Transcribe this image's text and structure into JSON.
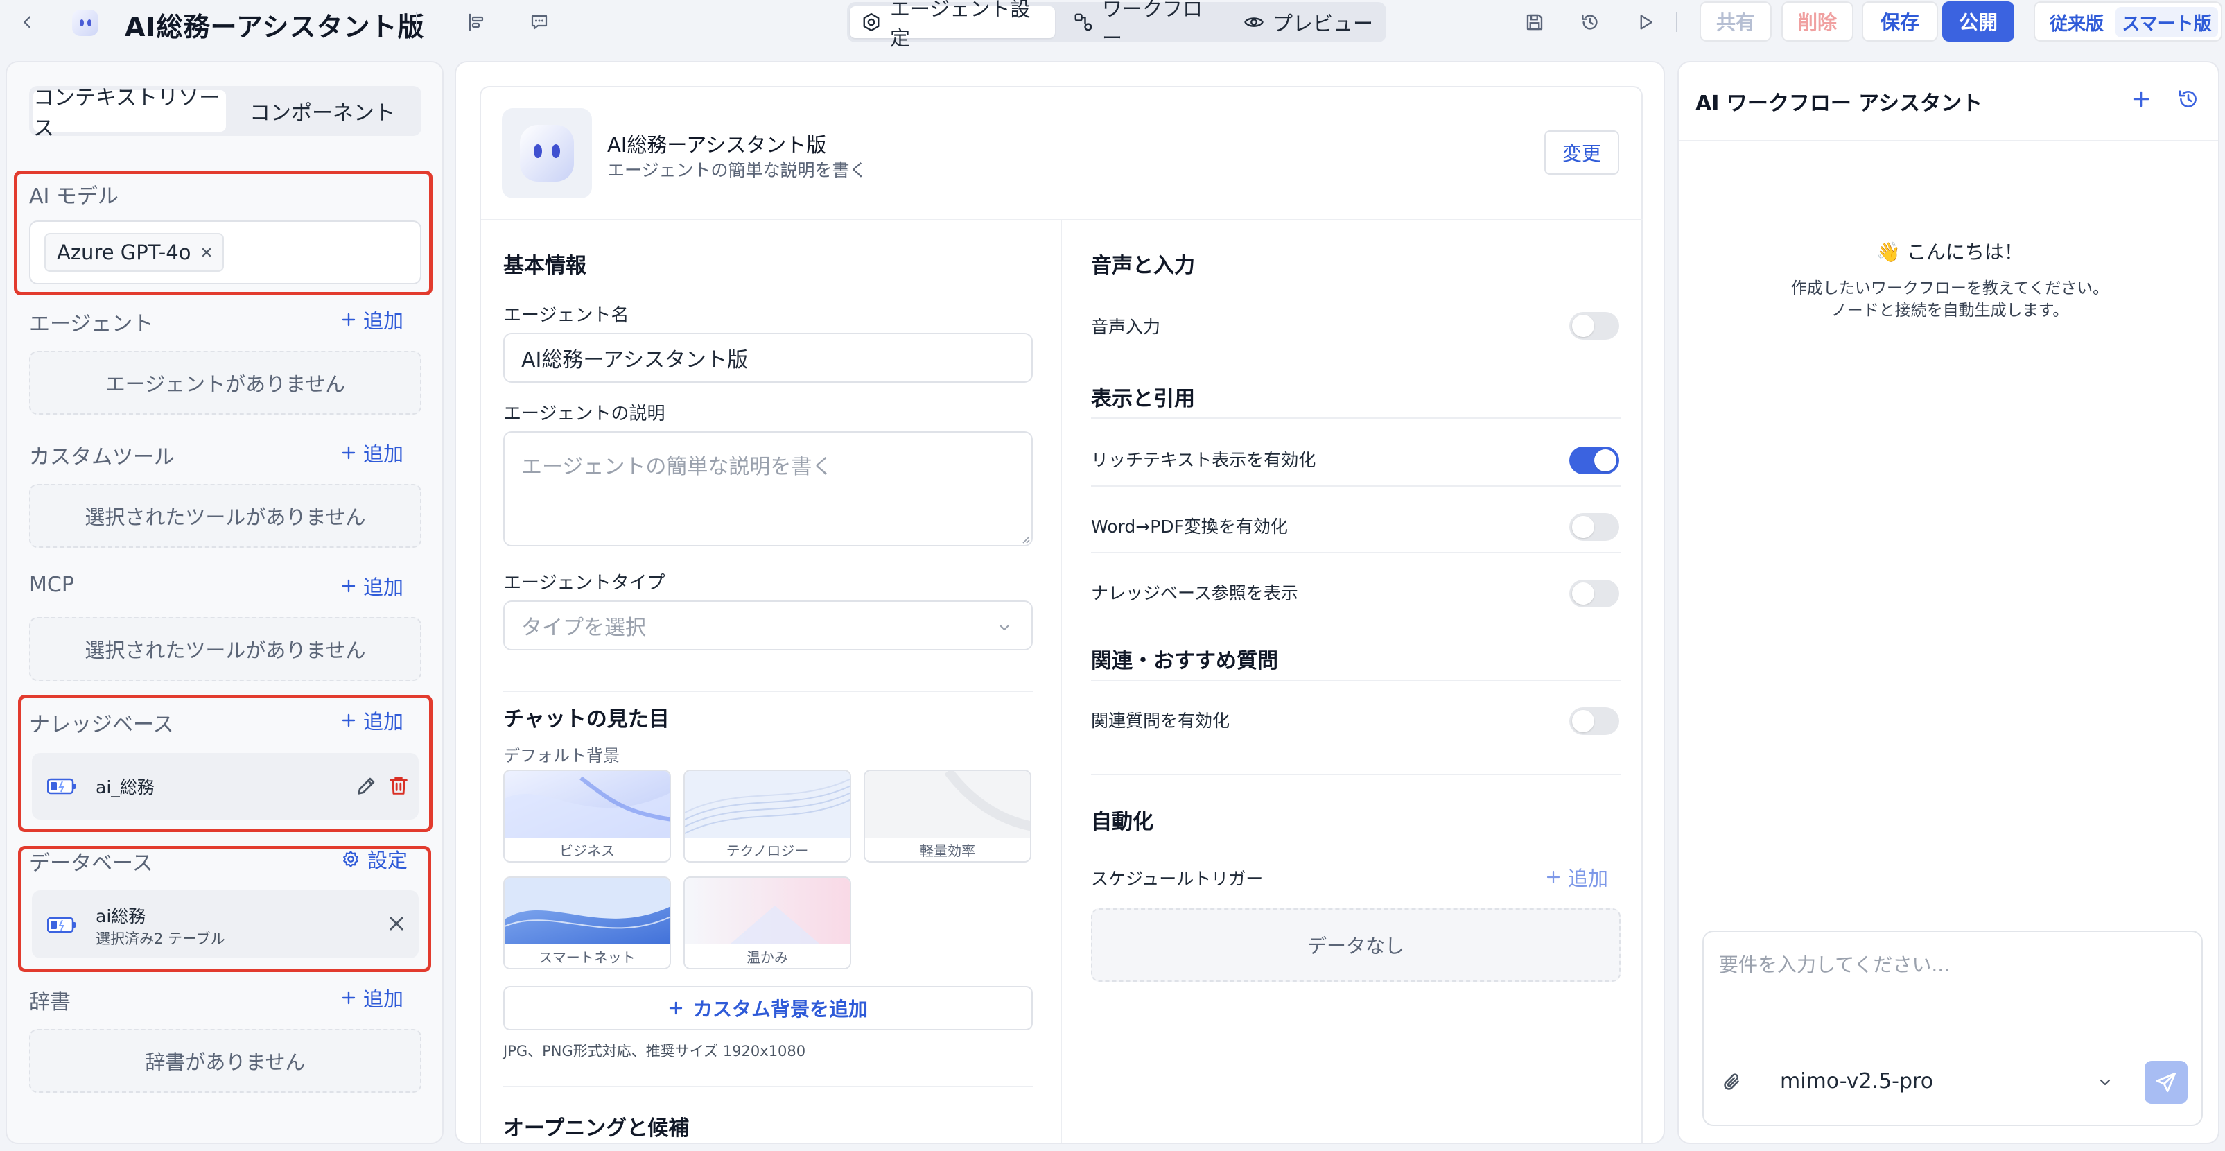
{
  "topbar": {
    "app_title": "AI総務ーアシスタント版",
    "tabs": [
      "エージェント設定",
      "ワークフロー",
      "プレビュー"
    ],
    "share_label": "共有",
    "delete_label": "削除",
    "save_label": "保存",
    "publish_label": "公開",
    "classic_label": "従来版",
    "smart_label": "スマート版"
  },
  "left": {
    "tabs": [
      "コンテキストリソース",
      "コンポーネント"
    ],
    "ai_model": {
      "label": "AI モデル",
      "selected": "Azure GPT-4o"
    },
    "agents": {
      "label": "エージェント",
      "add": "追加",
      "empty": "エージェントがありません"
    },
    "custom_tools": {
      "label": "カスタムツール",
      "add": "追加",
      "empty": "選択されたツールがありません"
    },
    "mcp": {
      "label": "MCP",
      "add": "追加",
      "empty": "選択されたツールがありません"
    },
    "knowledge": {
      "label": "ナレッジベース",
      "add": "追加",
      "item_name": "ai_総務"
    },
    "database": {
      "label": "データベース",
      "settings": "設定",
      "item_name": "ai総務",
      "item_sub": "選択済み2 テーブル"
    },
    "dictionary": {
      "label": "辞書",
      "add": "追加",
      "empty": "辞書がありません"
    }
  },
  "center": {
    "agent_name": "AI総務ーアシスタント版",
    "agent_desc_hint": "エージェントの簡単な説明を書く",
    "change_button": "変更",
    "basic": {
      "title": "基本情報",
      "name_label": "エージェント名",
      "name_value": "AI総務ーアシスタント版",
      "desc_label": "エージェントの説明",
      "desc_placeholder": "エージェントの簡単な説明を書く",
      "type_label": "エージェントタイプ",
      "type_placeholder": "タイプを選択"
    },
    "chat": {
      "title": "チャットの見た目",
      "default_bg": "デフォルト背景",
      "backgrounds": [
        "ビジネス",
        "テクノロジー",
        "軽量効率",
        "スマートネット",
        "温かみ"
      ],
      "add_custom": "カスタム背景を追加",
      "hint": "JPG、PNG形式対応、推奨サイズ 1920x1080",
      "next_title": "オープニングと候補"
    },
    "voice": {
      "title": "音声と入力",
      "voice_input": "音声入力",
      "voice_input_on": false
    },
    "display": {
      "title": "表示と引用",
      "rich_text": "リッチテキスト表示を有効化",
      "rich_text_on": true,
      "word_pdf": "Word→PDF変換を有効化",
      "word_pdf_on": false,
      "kb_ref": "ナレッジベース参照を表示",
      "kb_ref_on": false
    },
    "related": {
      "title": "関連・おすすめ質問",
      "enable": "関連質問を有効化",
      "enable_on": false
    },
    "automation": {
      "title": "自動化",
      "schedule": "スケジュールトリガー",
      "add": "追加",
      "empty": "データなし"
    }
  },
  "right": {
    "title": "AI ワークフロー アシスタント",
    "greeting": "👋 こんにちは！",
    "intro_line1": "作成したいワークフローを教えてください。",
    "intro_line2": "ノードと接続を自動生成します。",
    "input_placeholder": "要件を入力してください...",
    "model": "mimo-v2.5-pro"
  },
  "colors": {
    "accent": "#3b63e0",
    "danger": "#e23b2e",
    "highlight_box": "#e23b2e"
  }
}
